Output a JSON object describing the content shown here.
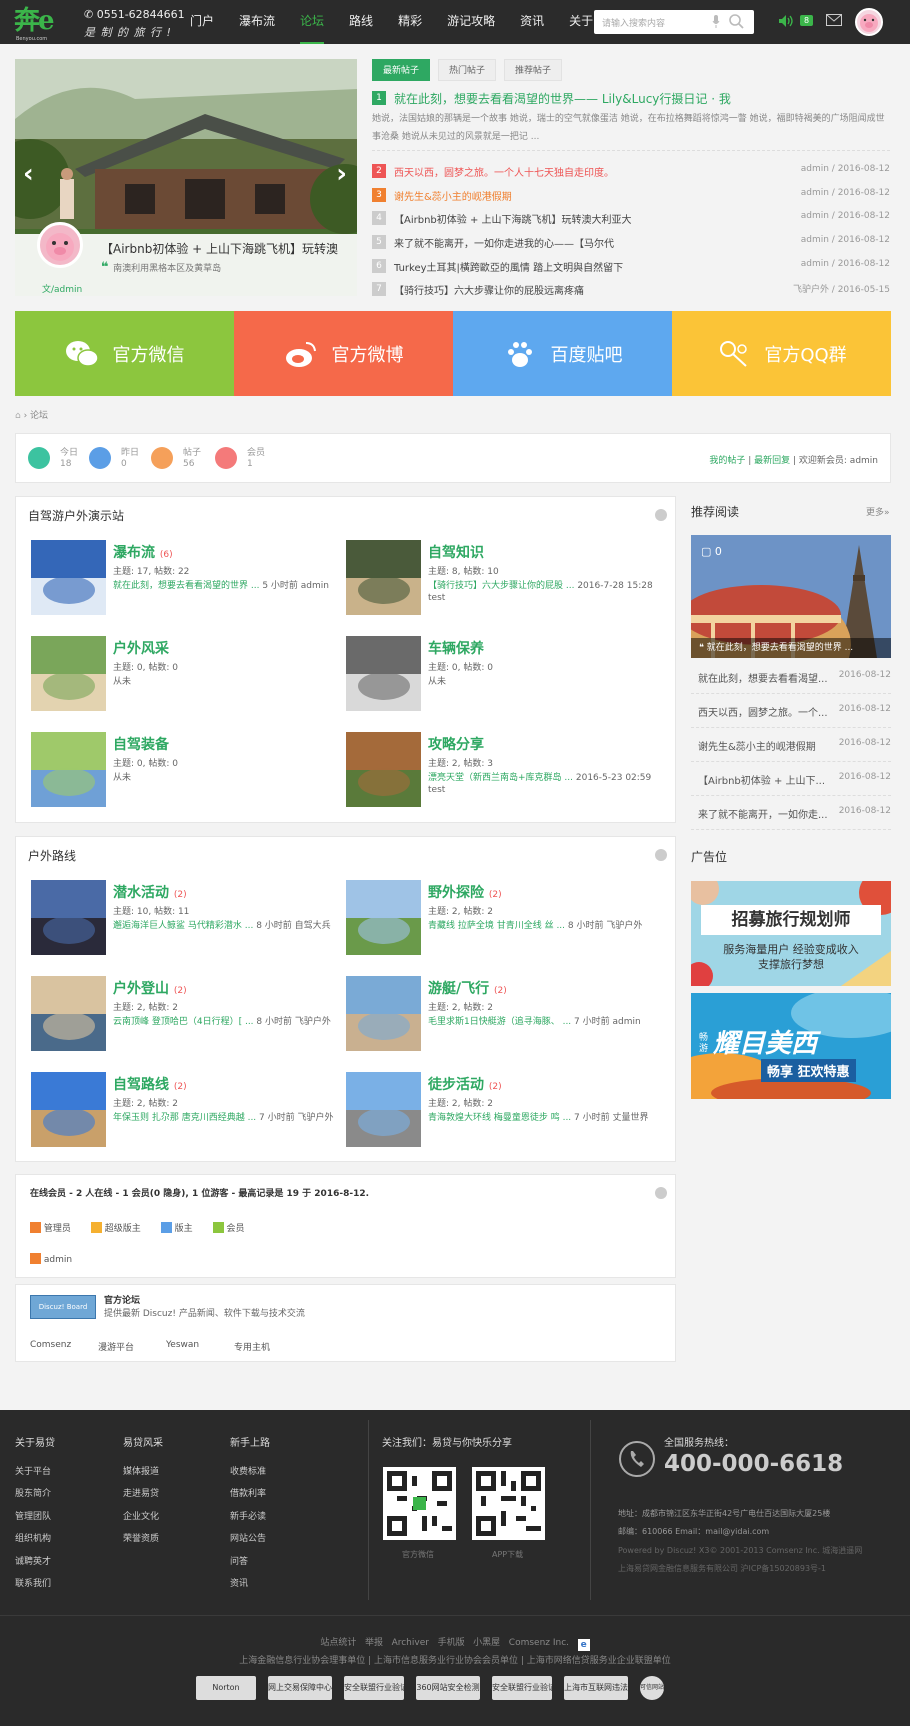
{
  "header": {
    "logo_text": "奔e",
    "logo_sub": "Benyou.com",
    "phone": "0551-62844661",
    "slogan": "是 制 的 旅 行 !",
    "nav": [
      "门户",
      "瀑布流",
      "论坛",
      "路线",
      "精彩",
      "游记攻略",
      "资讯",
      "关于"
    ],
    "active_nav": "论坛",
    "search_placeholder": "请输入搜索内容",
    "message_count": "8"
  },
  "slider": {
    "title": "【Airbnb初体验 + 上山下海跳飞机】玩转澳",
    "desc": "南澳利用黑格本区及黄草岛",
    "author": "文/admin"
  },
  "news": {
    "tabs": [
      "最新帖子",
      "热门帖子",
      "推荐帖子"
    ],
    "active_tab": "最新帖子",
    "headline": {
      "num": "1",
      "title": "就在此刻，想要去看看渴望的世界—— Lily&Lucy行摄日记 · 我",
      "desc": "她说，法国姑娘的那辆是一个故事 她说，瑞士的空气就像蛋洁 她说，在布拉格舞蹈将惊鸿一瞥 她说，福即特褐美的广场阻闻成世事沧桑 她说从未见过的风景就是一把记 ..."
    },
    "items": [
      {
        "num": "2",
        "title": "西天以西，圆梦之旅。一个人十七天独自走印度。",
        "meta": "admin / 2016-08-12",
        "color": "#e55"
      },
      {
        "num": "3",
        "title": "谢先生&蕊小主的岘港假期",
        "meta": "admin / 2016-08-12",
        "color": "#f08030"
      },
      {
        "num": "4",
        "title": "【Airbnb初体验 + 上山下海跳飞机】玩转澳大利亚大",
        "meta": "admin / 2016-08-12",
        "color": "#444"
      },
      {
        "num": "5",
        "title": "来了就不能离开，一如你走进我的心——【马尔代",
        "meta": "admin / 2016-08-12",
        "color": "#444"
      },
      {
        "num": "6",
        "title": "Turkey土耳其|橫跨歐亞的風情 踏上文明與自然留下",
        "meta": "admin / 2016-08-12",
        "color": "#444"
      },
      {
        "num": "7",
        "title": "【骑行技巧】六大步骤让你的屁股远离疼痛",
        "meta": "飞驴户外 / 2016-05-15",
        "color": "#444"
      }
    ]
  },
  "tiles": [
    {
      "label": "官方微信",
      "color": "#8cc63e",
      "icon": "wechat-icon"
    },
    {
      "label": "官方微博",
      "color": "#f5694a",
      "icon": "weibo-icon"
    },
    {
      "label": "百度贴吧",
      "color": "#5ea8ef",
      "icon": "baidu-paw-icon"
    },
    {
      "label": "官方QQ群",
      "color": "#fbc437",
      "icon": "qq-icon"
    }
  ],
  "breadcrumb": {
    "current": "论坛"
  },
  "stats": [
    {
      "label": "今日",
      "value": "18",
      "color": "#3cc3a0"
    },
    {
      "label": "昨日",
      "value": "0",
      "color": "#5b9ee6"
    },
    {
      "label": "帖子",
      "value": "56",
      "color": "#f5a05a"
    },
    {
      "label": "会员",
      "value": "1",
      "color": "#f47a7a"
    }
  ],
  "stat_links": {
    "my_posts": "我的帖子",
    "latest_replies": "最新回复",
    "welcome": "欢迎新会员: admin"
  },
  "section1": {
    "title": "自驾游户外演示站",
    "forums": [
      {
        "name": "瀑布流",
        "count": "(6)",
        "stats": "主题: 17, 帖数: 22",
        "last": "就在此刻，想要去看看渴望的世界 ...",
        "time": "5 小时前 admin",
        "user": ""
      },
      {
        "name": "自驾知识",
        "count": "",
        "stats": "主题: 8, 帖数: 10",
        "last": "【骑行技巧】六大步骤让你的屁股 ...",
        "time": "2016-7-28 15:28",
        "user": "test"
      },
      {
        "name": "户外风采",
        "count": "",
        "stats": "主题: 0, 帖数: 0",
        "last": "",
        "time": "",
        "user": "从未"
      },
      {
        "name": "车辆保养",
        "count": "",
        "stats": "主题: 0, 帖数: 0",
        "last": "",
        "time": "",
        "user": "从未"
      },
      {
        "name": "自驾装备",
        "count": "",
        "stats": "主题: 0, 帖数: 0",
        "last": "",
        "time": "",
        "user": "从未"
      },
      {
        "name": "攻略分享",
        "count": "",
        "stats": "主题: 2, 帖数: 3",
        "last": "漂亮天堂（新西兰南岛+库克群岛 ...",
        "time": "2016-5-23 02:59",
        "user": "test"
      }
    ]
  },
  "section2": {
    "title": "户外路线",
    "forums": [
      {
        "name": "潜水活动",
        "count": "(2)",
        "stats": "主题: 10, 帖数: 11",
        "last": "邂逅海洋巨人鲸鲨 马代精彩潜水 ...",
        "time": "8 小时前 自驾大兵"
      },
      {
        "name": "野外探险",
        "count": "(2)",
        "stats": "主题: 2, 帖数: 2",
        "last": "青藏线 拉萨全境 甘青川全线 丝 ...",
        "time": "8 小时前 飞驴户外"
      },
      {
        "name": "户外登山",
        "count": "(2)",
        "stats": "主题: 2, 帖数: 2",
        "last": "云南顶峰 登顶哈巴（4日行程）[ ...",
        "time": "8 小时前 飞驴户外"
      },
      {
        "name": "游艇/飞行",
        "count": "(2)",
        "stats": "主题: 2, 帖数: 2",
        "last": "毛里求斯1日快艇游（追寻海豚、 ...",
        "time": "7 小时前 admin"
      },
      {
        "name": "自驾路线",
        "count": "(2)",
        "stats": "主题: 2, 帖数: 2",
        "last": "年保玉则 扎尕那 唐克川西经典越 ...",
        "time": "7 小时前 飞驴户外"
      },
      {
        "name": "徒步活动",
        "count": "(2)",
        "stats": "主题: 2, 帖数: 2",
        "last": "青海敦煌大环线 梅曼童恩徒步 鸣 ...",
        "time": "7 小时前 丈量世界"
      }
    ]
  },
  "online": {
    "summary": "在线会员 - 2 人在线 - 1 会员(0 隐身), 1 位游客 - 最高记录是 19 于 2016-8-12.",
    "legend": [
      "管理员",
      "超级版主",
      "版主",
      "会员"
    ],
    "users": [
      "admin"
    ]
  },
  "links": {
    "official_title": "官方论坛",
    "official_desc": "提供最新 Discuz! 产品新闻、软件下载与技术交流",
    "logo_text": "Discuz! Board",
    "items": [
      "Comsenz",
      "漫游平台",
      "Yeswan",
      "专用主机"
    ]
  },
  "sidebar": {
    "recommend_title": "推荐阅读",
    "more": "更多»",
    "featured_caption": "就在此刻，想要去看看渴望的世界 ...",
    "featured_comments": "0",
    "reads": [
      {
        "title": "就在此刻，想要去看看渴望...",
        "date": "2016-08-12"
      },
      {
        "title": "西天以西，圆梦之旅。一个...",
        "date": "2016-08-12"
      },
      {
        "title": "谢先生&蕊小主的岘港假期",
        "date": "2016-08-12"
      },
      {
        "title": "【Airbnb初体验 + 上山下...",
        "date": "2016-08-12"
      },
      {
        "title": "来了就不能离开，一如你走...",
        "date": "2016-08-12"
      }
    ],
    "ad_title": "广告位",
    "ad1_main": "招募旅行规划师",
    "ad1_sub1": "服务海量用户  经验变成收入",
    "ad1_sub2": "支撑旅行梦想",
    "ad2_tag": "畅游",
    "ad2_main": "耀目美西",
    "ad2_sub": "畅享 狂欢特惠"
  },
  "footer": {
    "cols": [
      {
        "title": "关于易贷",
        "items": [
          "关于平台",
          "股东简介",
          "管理团队",
          "组织机构",
          "诚聘英才",
          "联系我们"
        ]
      },
      {
        "title": "易贷风采",
        "items": [
          "媒体报道",
          "走进易贷",
          "企业文化",
          "荣誉资质"
        ]
      },
      {
        "title": "新手上路",
        "items": [
          "收费标准",
          "借款利率",
          "新手必读",
          "网站公告",
          "问答",
          "资讯"
        ]
      }
    ],
    "follow_title": "关注我们：易贷与你快乐分享",
    "qr_labels": [
      "官方微信",
      "APP下载"
    ],
    "hotline_label": "全国服务热线：",
    "hotline": "400-000-6618",
    "address": "地址：成都市锦江区东华正街42号广电仕百达国际大厦25楼",
    "email": "邮编：610066 Email：mail@yidai.com",
    "powered": "Powered by Discuz! X3© 2001-2013 Comsenz Inc.  城海逍遥网",
    "icp": "上海易贷网金融信息服务有限公司 沪ICP备15020893号-1",
    "bottom_links": [
      "站点统计",
      "举报",
      "Archiver",
      "手机版",
      "小黑屋",
      "Comsenz Inc."
    ],
    "member_line": "上海金融信息行业协会理事单位 | 上海市信息服务业行业协会会员单位 | 上海市网络信贷服务业企业联盟单位",
    "certs": [
      "Norton",
      "网上交易保障中心",
      "安全联盟行业验证",
      "360网站安全检测",
      "安全联盟行业验证",
      "上海市互联网违法和不良信息举报中心",
      "可信网站"
    ]
  }
}
